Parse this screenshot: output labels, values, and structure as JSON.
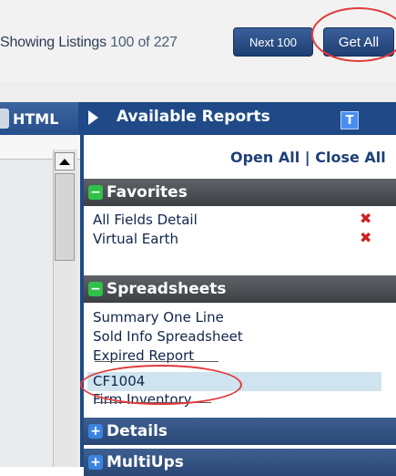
{
  "toolbar": {
    "listing_prefix": "Showing Listings",
    "count_shown": "100",
    "of_label": "of",
    "total": "227",
    "next_label": "Next 100",
    "get_all_label": "Get All"
  },
  "header": {
    "html_tab": "HTML",
    "reports_title": "Available Reports",
    "t_icon": "T"
  },
  "panel": {
    "open_all": "Open All",
    "separator": "|",
    "close_all": "Close All",
    "sections": [
      {
        "title": "Favorites",
        "state": "expanded",
        "items": [
          {
            "label": "All Fields Detail",
            "removable": true
          },
          {
            "label": "Virtual Earth",
            "removable": true
          }
        ]
      },
      {
        "title": "Spreadsheets",
        "state": "expanded",
        "items": [
          {
            "label": "Summary One Line"
          },
          {
            "label": "Sold Info Spreadsheet"
          },
          {
            "label": "Expired Report"
          },
          {
            "label": "CF1004",
            "selected": true
          },
          {
            "label": "Firm Inventory"
          }
        ]
      },
      {
        "title": "Details",
        "state": "collapsed"
      },
      {
        "title": "MultiUps",
        "state": "collapsed"
      }
    ]
  },
  "icons": {
    "remove": "red-x-icon",
    "expand": "plus-icon",
    "collapse": "minus-icon",
    "scroll_up": "triangle-up-icon"
  },
  "colors": {
    "header_blue": "#1f4a87",
    "button_blue": "#2a4c84",
    "annotation_red": "#e23a3a",
    "expand_green": "#2fc14a",
    "selected_row": "#cfe4ef"
  }
}
